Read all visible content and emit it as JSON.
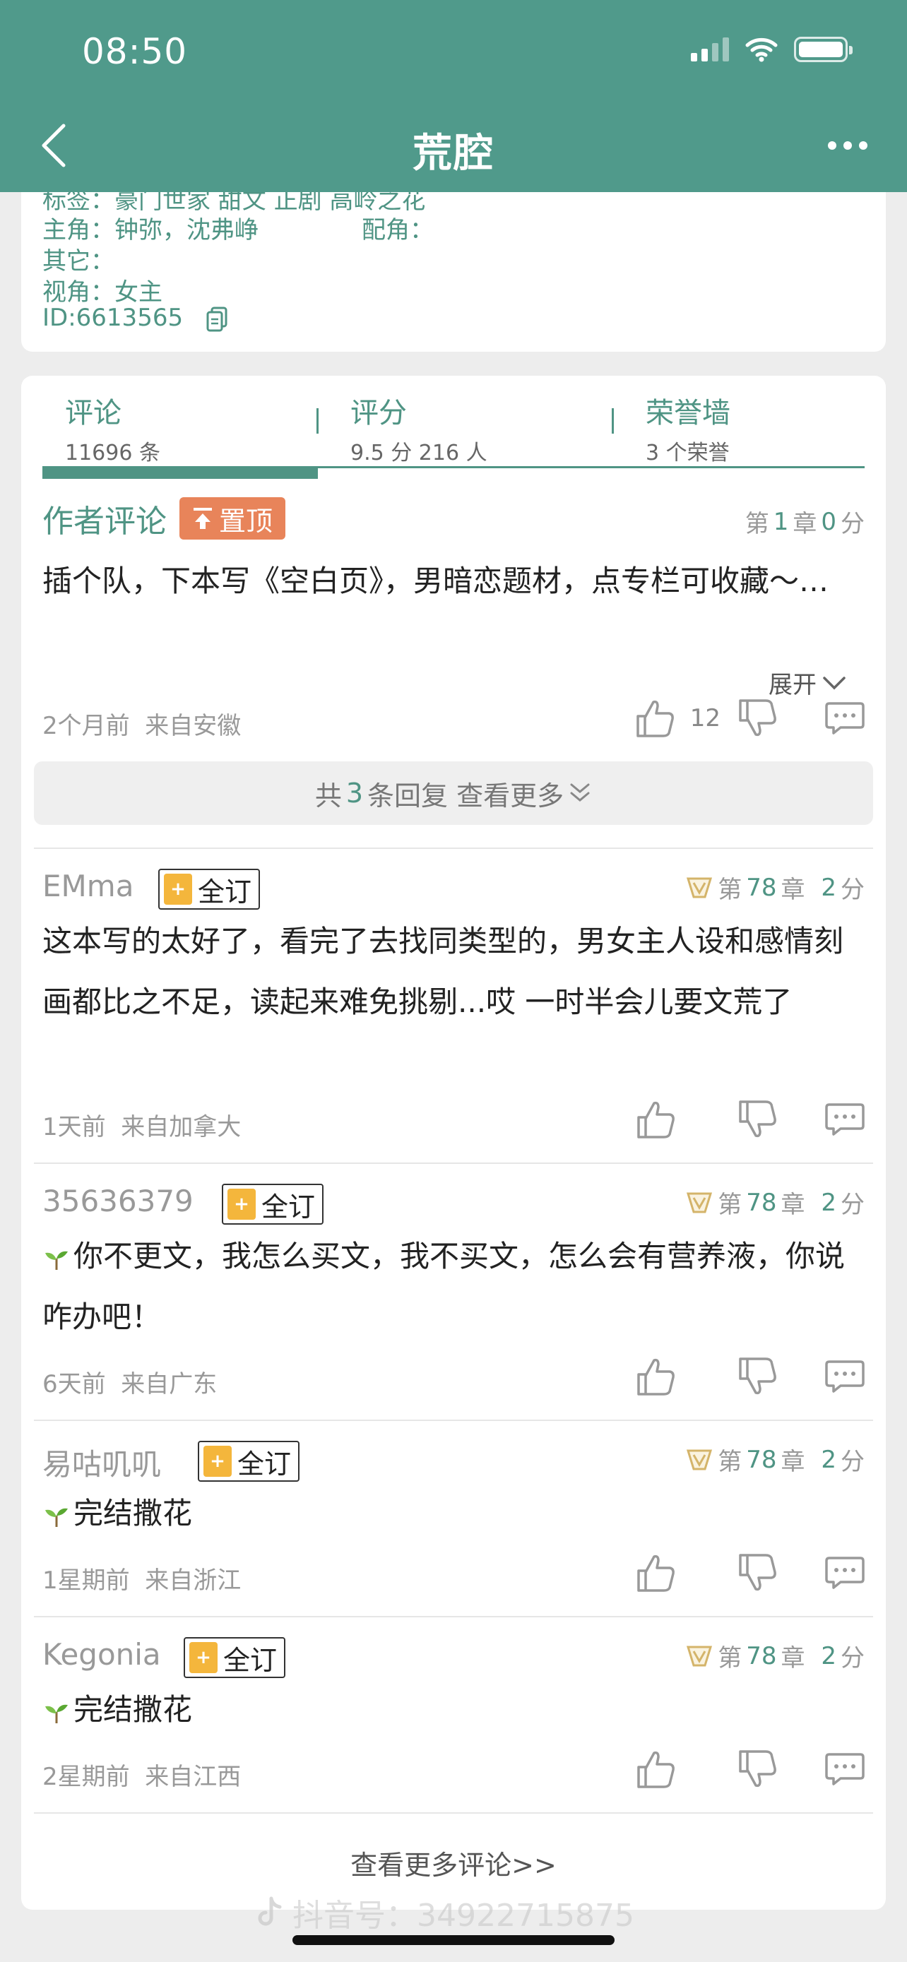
{
  "status_bar": {
    "time": "08:50"
  },
  "nav": {
    "title": "荒腔"
  },
  "info": {
    "tags_line": "标签：豪门世家  甜文  正剧  高岭之花",
    "lead_label": "主角：",
    "lead_value": "钟弥，沈弗峥",
    "support_label": "配角：",
    "other_label": "其它：",
    "pov_label": "视角：",
    "pov_value": "女主",
    "id_text": "ID:6613565"
  },
  "tabs": [
    {
      "label": "评论",
      "sub": "11696 条"
    },
    {
      "label": "评分",
      "sub": "9.5 分 216 人"
    },
    {
      "label": "荣誉墙",
      "sub": "3 个荣誉"
    }
  ],
  "author_comment": {
    "label": "作者评论",
    "pin_label": "置顶",
    "chap_prefix": "第",
    "chap_num": "1",
    "chap_mid": "章",
    "score_num": "0",
    "score_unit": "分",
    "body": "插个队，下本写《空白页》，男暗恋题材，点专栏可收藏～…",
    "expand_label": "展开",
    "time": "2个月前",
    "location": "来自安徽",
    "like_count": "12",
    "reply_prefix": "共",
    "reply_num": "3",
    "reply_suffix": "条回复 查看更多"
  },
  "comments": [
    {
      "name": "EMma",
      "badge": "全订",
      "chap_prefix": "第",
      "chap_num": "78",
      "chap_mid": "章",
      "score_num": "2",
      "score_unit": "分",
      "body": "这本写的太好了，看完了去找同类型的，男女主人设和感情刻画都比之不足，读起来难免挑剔...哎 一时半会儿要文荒了",
      "time": "1天前",
      "location": "来自加拿大"
    },
    {
      "name": "35636379",
      "badge": "全订",
      "chap_prefix": "第",
      "chap_num": "78",
      "chap_mid": "章",
      "score_num": "2",
      "score_unit": "分",
      "body": "你不更文，我怎么买文，我不买文，怎么会有营养液，你说咋办吧！",
      "time": "6天前",
      "location": "来自广东"
    },
    {
      "name": "易咕叽叽",
      "badge": "全订",
      "chap_prefix": "第",
      "chap_num": "78",
      "chap_mid": "章",
      "score_num": "2",
      "score_unit": "分",
      "body": "完结撒花",
      "time": "1星期前",
      "location": "来自浙江"
    },
    {
      "name": "Kegonia",
      "badge": "全订",
      "chap_prefix": "第",
      "chap_num": "78",
      "chap_mid": "章",
      "score_num": "2",
      "score_unit": "分",
      "body": "完结撒花",
      "time": "2星期前",
      "location": "来自江西"
    }
  ],
  "footer": {
    "more_label": "查看更多评论>>"
  },
  "watermark": {
    "text": "抖音号：34922715875"
  },
  "colors": {
    "theme": "#509a8b",
    "accent": "#4f9484",
    "pin": "#e8845a",
    "badge": "#f4b63c"
  },
  "icons": [
    "back-icon",
    "more-icon",
    "copy-icon",
    "thumb-up-icon",
    "thumb-down-icon",
    "comment-icon",
    "sprout-icon",
    "vip-diamond-icon",
    "book-icon",
    "chevron-down-icon",
    "double-chevron-down-icon"
  ]
}
